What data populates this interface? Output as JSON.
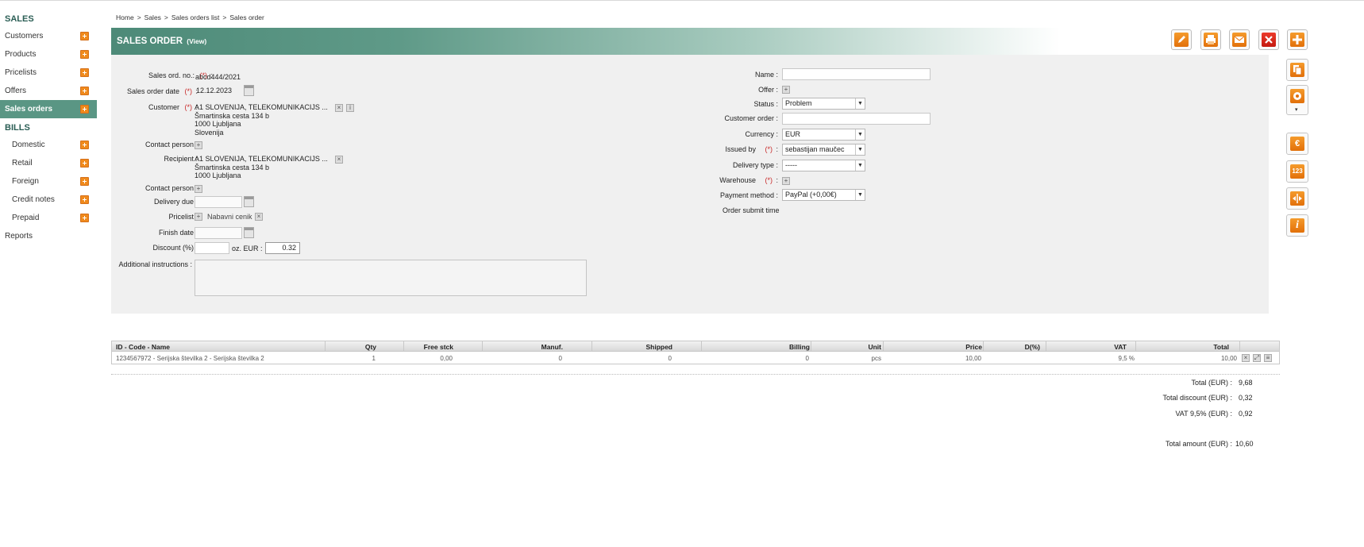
{
  "sidebar": {
    "sales_header": "SALES",
    "sales_items": [
      {
        "label": "Customers"
      },
      {
        "label": "Products"
      },
      {
        "label": "Pricelists"
      },
      {
        "label": "Offers"
      },
      {
        "label": "Sales orders"
      }
    ],
    "bills_header": "BILLS",
    "bills_items": [
      {
        "label": "Domestic"
      },
      {
        "label": "Retail"
      },
      {
        "label": "Foreign"
      },
      {
        "label": "Credit notes"
      },
      {
        "label": "Prepaid"
      }
    ],
    "reports": "Reports"
  },
  "breadcrumb": [
    "Home",
    ">",
    "Sales",
    ">",
    "Sales orders list",
    ">",
    "Sales order"
  ],
  "header": {
    "title": "SALES ORDER",
    "mode": "(View)"
  },
  "form": {
    "sales_ord_no_label": "Sales ord. no.:",
    "sales_ord_no": "abcd444/2021",
    "sales_order_date_label": "Sales order date",
    "sales_order_date": "12.12.2023",
    "customer_label": "Customer",
    "customer_lines": [
      "A1 SLOVENIJA, TELEKOMUNIKACIJS ...",
      "Šmartinska cesta 134 b",
      "1000 Ljubljana",
      "Slovenija"
    ],
    "contact_person_label": "Contact person :",
    "recipient_label": "Recipient :",
    "recipient_lines": [
      "A1 SLOVENIJA, TELEKOMUNIKACIJS ...",
      "Šmartinska cesta 134 b",
      "1000 Ljubljana"
    ],
    "contact_person2_label": "Contact person :",
    "delivery_due_label": "Delivery due :",
    "pricelist_label": "Pricelist :",
    "pricelist_value": "Nabavni cenik",
    "finish_date_label": "Finish date :",
    "discount_label": "Discount (%) :",
    "discount_eur_label": "oz. EUR :",
    "discount_eur": "0.32",
    "additional_label": "Additional instructions :",
    "req_mark": "(*)",
    "colon": ":",
    "name_label": "Name :",
    "offer_label": "Offer :",
    "status_label": "Status :",
    "status_value": "Problem",
    "customer_order_label": "Customer order :",
    "currency_label": "Currency :",
    "currency_value": "EUR",
    "issued_by_label": "Issued by",
    "issued_by_value": "sebastijan maučec",
    "delivery_type_label": "Delivery type :",
    "delivery_type_value": "-----",
    "warehouse_label": "Warehouse",
    "payment_label": "Payment method :",
    "payment_value": "PayPal (+0,00€)",
    "submit_time_label": "Order submit time"
  },
  "table": {
    "headers": [
      "ID - Code - Name",
      "Qty",
      "Free stck",
      "Manuf.",
      "Shipped",
      "Billing",
      "Unit",
      "Price",
      "D(%)",
      "VAT",
      "Total"
    ],
    "rows": [
      {
        "name": "1234567972 - Serijska številka 2 - Serijska številka 2",
        "qty": "1",
        "free": "0,00",
        "manuf": "0",
        "shipped": "0",
        "billing": "0",
        "unit": "pcs",
        "price": "10,00",
        "disc": "",
        "vat": "9,5 %",
        "total": "10,00"
      }
    ]
  },
  "totals": {
    "total_label": "Total (EUR) :",
    "total": "9,68",
    "discount_label": "Total discount (EUR) :",
    "discount": "0,32",
    "vat_label": "VAT 9,5% (EUR) :",
    "vat": "0,92",
    "amount_label": "Total amount (EUR) :",
    "amount": "10,60"
  },
  "icons": {
    "toolbar": [
      "edit-icon",
      "print-icon",
      "email-icon",
      "delete-icon",
      "add-icon"
    ],
    "side": [
      "copy-icon",
      "settings-icon",
      "euro-icon",
      "numbering-icon",
      "split-icon",
      "info-icon"
    ],
    "side_labels": {
      "euro": "€",
      "numbering": "123",
      "info": "i"
    }
  },
  "colors": {
    "accent": "#5a9684",
    "header": "#4d8a78",
    "orange": "#f08a1c",
    "danger": "#d4261a"
  }
}
